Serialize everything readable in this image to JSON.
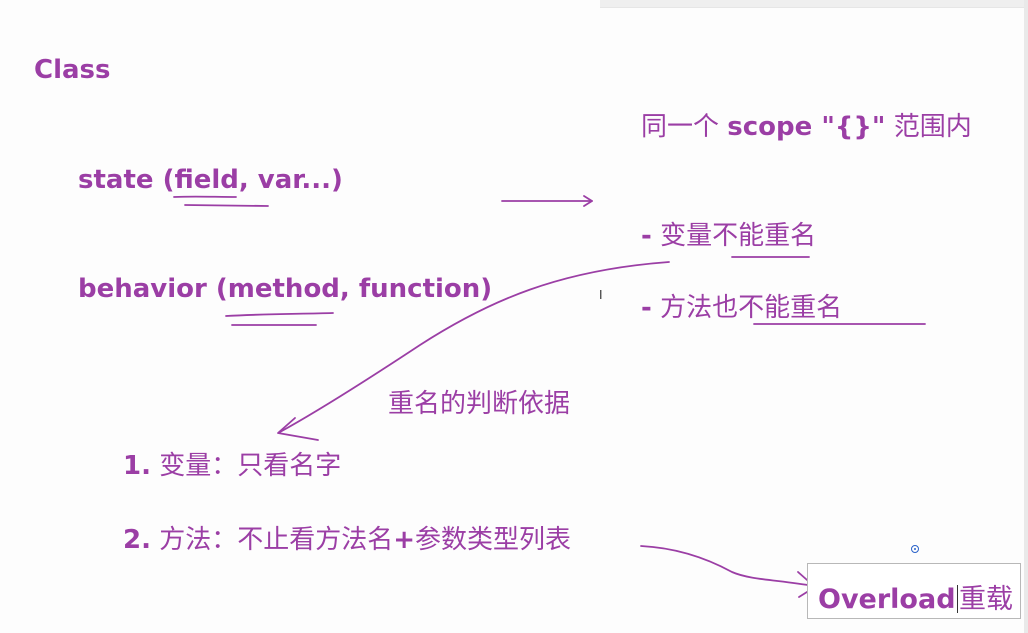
{
  "title": "Class",
  "state_line": "state (field, var...)",
  "behavior_line": "behavior (method, function)",
  "scope_note": {
    "prefix": "同一个",
    "bold": "scope \"{}\"",
    "suffix": "范围内"
  },
  "rule_variables": {
    "dash": "-",
    "lead": "变量",
    "underlined": "不能重名"
  },
  "rule_methods": {
    "dash": "-",
    "lead": "方法也",
    "underlined": "不能重名"
  },
  "criteria_heading": "重名的判断依据",
  "criteria": [
    {
      "num": "1.",
      "text": "变量：只看名字"
    },
    {
      "num": "2.",
      "text": "方法：不止看方法名",
      "plus": "+",
      "rest": "参数类型列表"
    }
  ],
  "overload": {
    "en": "Overload",
    "zh": "重载"
  },
  "colors": {
    "ink": "#9b3ea5",
    "background": "#fdfdfd"
  }
}
